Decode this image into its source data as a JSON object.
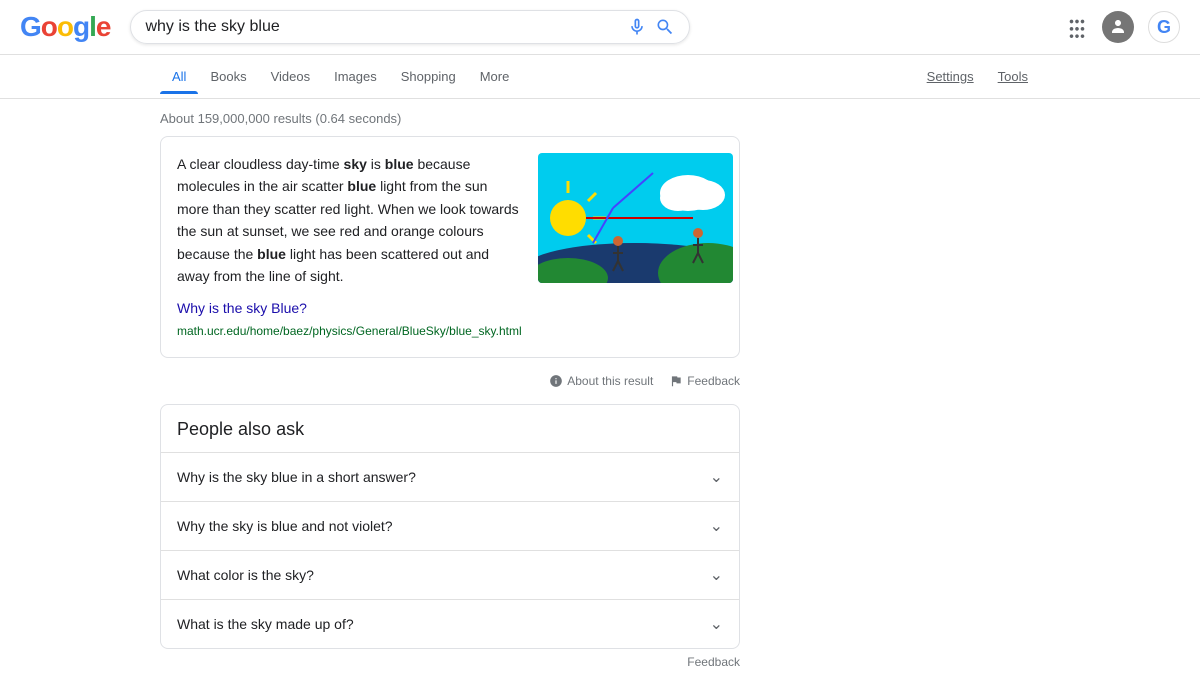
{
  "header": {
    "logo": {
      "g1": "G",
      "o1": "o",
      "o2": "o",
      "g2": "g",
      "l": "l",
      "e": "e"
    },
    "search": {
      "query": "why is the sky blue",
      "placeholder": "Search"
    }
  },
  "nav": {
    "tabs": [
      {
        "label": "All",
        "active": true
      },
      {
        "label": "Books",
        "active": false
      },
      {
        "label": "Videos",
        "active": false
      },
      {
        "label": "Images",
        "active": false
      },
      {
        "label": "Shopping",
        "active": false
      },
      {
        "label": "More",
        "active": false
      }
    ],
    "right": [
      {
        "label": "Settings"
      },
      {
        "label": "Tools"
      }
    ]
  },
  "results": {
    "count": "About 159,000,000 results (0.64 seconds)",
    "featured_snippet": {
      "text_before_bold1": "A clear cloudless day-time ",
      "bold1": "sky",
      "text_after_bold1": " is ",
      "bold2": "blue",
      "text_after_bold2": " because molecules in the air scatter ",
      "bold3": "blue",
      "text_after_bold3": " light from the sun more than they scatter red light. When we look towards the sun at sunset, we see red and orange colours because the ",
      "bold4": "blue",
      "text_after_bold4": " light has been scattered out and away from the line of sight.",
      "link_text": "Why is the sky Blue?",
      "link_url": "#",
      "link_display": "math.ucr.edu/home/baez/physics/General/BlueSky/blue_sky.html"
    },
    "meta": {
      "about_label": "About this result",
      "feedback_label": "Feedback"
    }
  },
  "people_also_ask": {
    "title": "People also ask",
    "questions": [
      "Why is the sky blue in a short answer?",
      "Why the sky is blue and not violet?",
      "What color is the sky?",
      "What is the sky made up of?"
    ]
  },
  "footer_feedback": "Feedback"
}
